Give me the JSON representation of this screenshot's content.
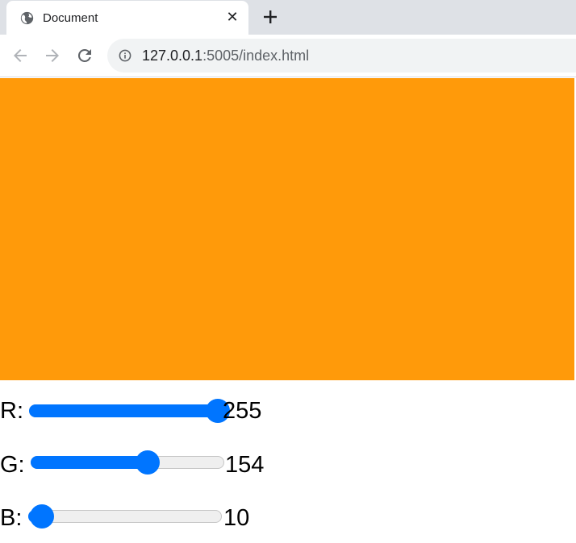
{
  "browser": {
    "tab": {
      "title": "Document",
      "favicon": "globe-icon",
      "close_icon": "close-icon"
    },
    "new_tab_icon": "plus-icon",
    "nav": {
      "back_icon": "arrow-left-icon",
      "forward_icon": "arrow-right-icon",
      "reload_icon": "reload-icon"
    },
    "address_bar": {
      "info_icon": "info-icon",
      "url_host": "127.0.0.1",
      "url_rest": ":5005/index.html"
    }
  },
  "page": {
    "color_box": {
      "color": "#ff9a0a"
    },
    "sliders": [
      {
        "label": "R:",
        "value": "255",
        "min": 0,
        "max": 255,
        "fraction": 1.0
      },
      {
        "label": "G:",
        "value": "154",
        "min": 0,
        "max": 255,
        "fraction": 0.604
      },
      {
        "label": "B:",
        "value": "10",
        "min": 0,
        "max": 255,
        "fraction": 0.039
      }
    ]
  },
  "colors": {
    "slider_accent": "#0075ff",
    "tab_strip": "#dee1e6"
  }
}
